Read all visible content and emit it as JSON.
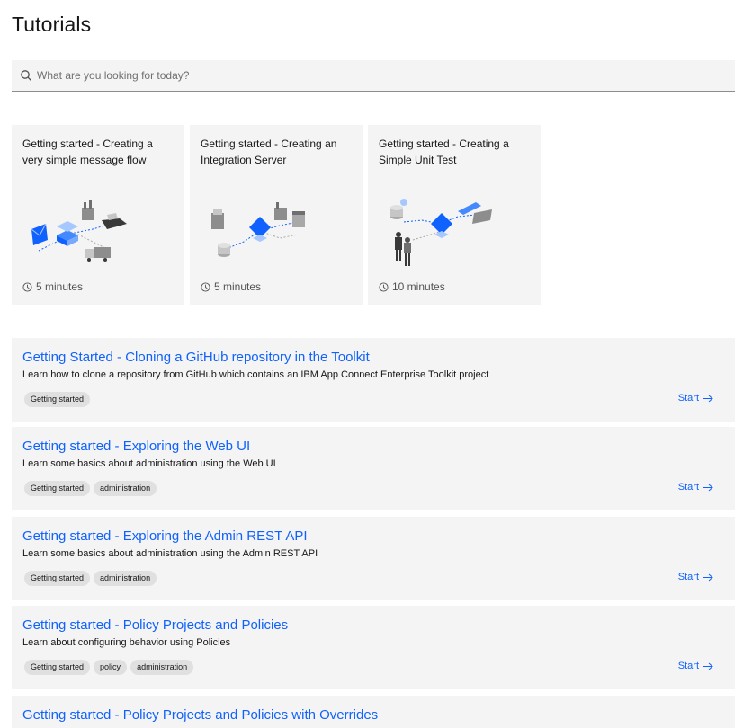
{
  "page": {
    "title": "Tutorials"
  },
  "search": {
    "placeholder": "What are you looking for today?"
  },
  "cards": [
    {
      "title": "Getting started - Creating a very simple message flow",
      "duration": "5 minutes"
    },
    {
      "title": "Getting started - Creating an Integration Server",
      "duration": "5 minutes"
    },
    {
      "title": "Getting started - Creating a Simple Unit Test",
      "duration": "10 minutes"
    }
  ],
  "tutorials": [
    {
      "title": "Getting Started - Cloning a GitHub repository in the Toolkit",
      "description": "Learn how to clone a repository from GitHub which contains an IBM App Connect Enterprise Toolkit project",
      "tags": [
        "Getting started"
      ],
      "action": "Start"
    },
    {
      "title": "Getting started - Exploring the Web UI",
      "description": "Learn some basics about administration using the Web UI",
      "tags": [
        "Getting started",
        "administration"
      ],
      "action": "Start"
    },
    {
      "title": "Getting started - Exploring the Admin REST API",
      "description": "Learn some basics about administration using the Admin REST API",
      "tags": [
        "Getting started",
        "administration"
      ],
      "action": "Start"
    },
    {
      "title": "Getting started - Policy Projects and Policies",
      "description": "Learn about configuring behavior using Policies",
      "tags": [
        "Getting started",
        "policy",
        "administration"
      ],
      "action": "Start"
    },
    {
      "title": "Getting started - Policy Projects and Policies with Overrides",
      "description": "",
      "tags": [],
      "action": ""
    }
  ],
  "colors": {
    "link": "#0f62fe",
    "tile": "#f4f4f4",
    "tag": "#e0e0e0",
    "text": "#161616"
  },
  "icons": {
    "search": "search-icon",
    "clock": "clock-icon",
    "arrow": "arrow-right-icon"
  }
}
